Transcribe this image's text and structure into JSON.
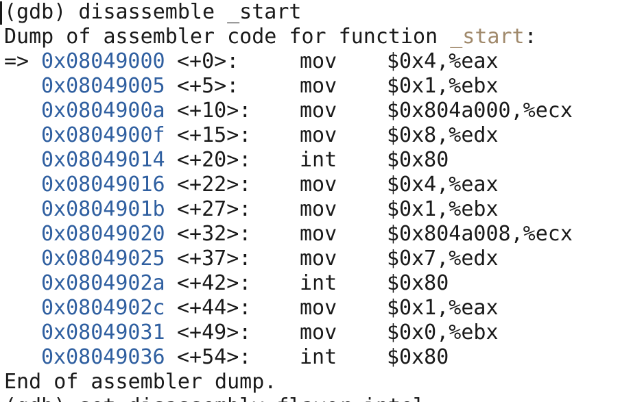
{
  "terminal": {
    "command_prompt": "(gdb)",
    "command_text": "disassemble _start",
    "dump_prefix": "Dump of assembler code for function ",
    "function_name": "_start",
    "dump_suffix": ":",
    "current_marker": "=>",
    "instructions": [
      {
        "address": "0x08049000",
        "offset": "<+0>:",
        "opcode": "mov",
        "operands": "$0x4,%eax",
        "current": true
      },
      {
        "address": "0x08049005",
        "offset": "<+5>:",
        "opcode": "mov",
        "operands": "$0x1,%ebx",
        "current": false
      },
      {
        "address": "0x0804900a",
        "offset": "<+10>:",
        "opcode": "mov",
        "operands": "$0x804a000,%ecx",
        "current": false
      },
      {
        "address": "0x0804900f",
        "offset": "<+15>:",
        "opcode": "mov",
        "operands": "$0x8,%edx",
        "current": false
      },
      {
        "address": "0x08049014",
        "offset": "<+20>:",
        "opcode": "int",
        "operands": "$0x80",
        "current": false
      },
      {
        "address": "0x08049016",
        "offset": "<+22>:",
        "opcode": "mov",
        "operands": "$0x4,%eax",
        "current": false
      },
      {
        "address": "0x0804901b",
        "offset": "<+27>:",
        "opcode": "mov",
        "operands": "$0x1,%ebx",
        "current": false
      },
      {
        "address": "0x08049020",
        "offset": "<+32>:",
        "opcode": "mov",
        "operands": "$0x804a008,%ecx",
        "current": false
      },
      {
        "address": "0x08049025",
        "offset": "<+37>:",
        "opcode": "mov",
        "operands": "$0x7,%edx",
        "current": false
      },
      {
        "address": "0x0804902a",
        "offset": "<+42>:",
        "opcode": "int",
        "operands": "$0x80",
        "current": false
      },
      {
        "address": "0x0804902c",
        "offset": "<+44>:",
        "opcode": "mov",
        "operands": "$0x1,%eax",
        "current": false
      },
      {
        "address": "0x08049031",
        "offset": "<+49>:",
        "opcode": "mov",
        "operands": "$0x0,%ebx",
        "current": false
      },
      {
        "address": "0x08049036",
        "offset": "<+54>:",
        "opcode": "int",
        "operands": "$0x80",
        "current": false
      }
    ],
    "end_text": "End of assembler dump.",
    "next_prompt_partial": "(gdb) set disassembly-flavor intel"
  },
  "colors": {
    "background": "#ffffff",
    "text": "#1a1a1a",
    "address": "#2f5fa0",
    "function_name": "#a0896b"
  }
}
